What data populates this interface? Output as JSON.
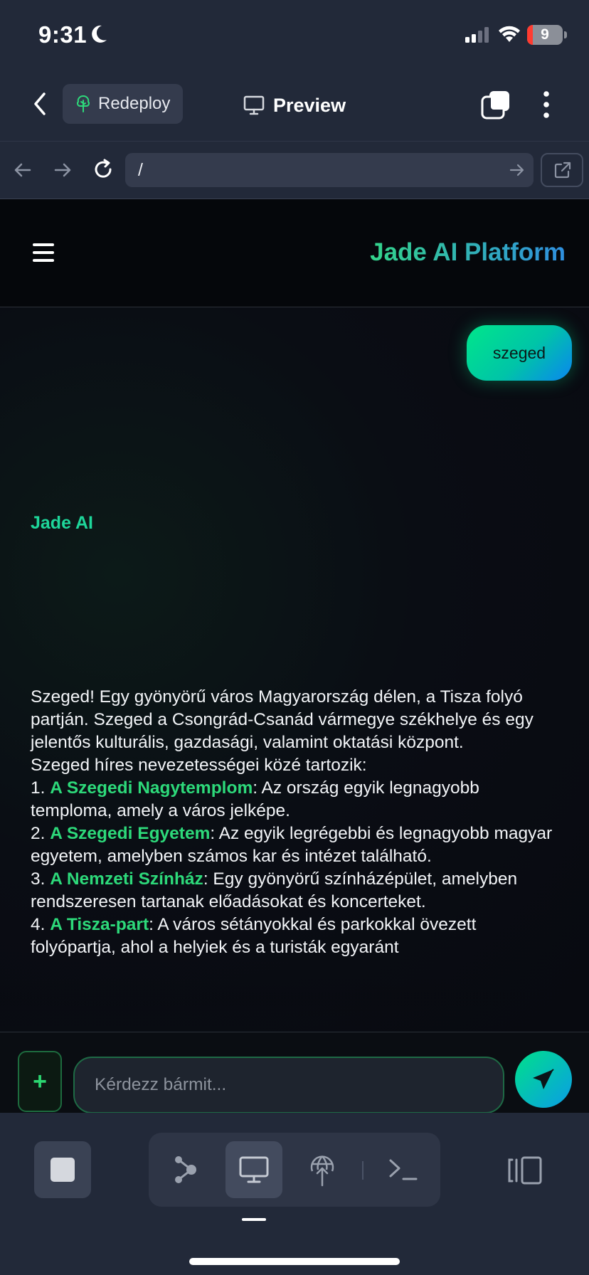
{
  "status_bar": {
    "time": "9:31",
    "battery": "9"
  },
  "nav": {
    "redeploy_label": "Redeploy",
    "preview_label": "Preview"
  },
  "browser": {
    "url": "/"
  },
  "app": {
    "title": "Jade AI Platform"
  },
  "chat": {
    "user_message": "szeged",
    "ai_name": "Jade AI",
    "intro": "Szeged! Egy gyönyörű város Magyarország délen, a Tisza folyó partján. Szeged a Csongrád-Csanád vármegye székhelye és egy jelentős kulturális, gazdasági, valamint oktatási központ.",
    "list_heading": "Szeged híres nevezetességei közé tartozik:",
    "items": [
      {
        "num": "1.",
        "name": "A Szegedi Nagytemplom",
        "desc": ": Az ország egyik legnagyobb temploma, amely a város jelképe."
      },
      {
        "num": "2.",
        "name": "A Szegedi Egyetem",
        "desc": ": Az egyik legrégebbi és legnagyobb magyar egyetem, amelyben számos kar és intézet található."
      },
      {
        "num": "3.",
        "name": "A Nemzeti Színház",
        "desc": ": Egy gyönyörű színházépület, amelyben rendszeresen tartanak előadásokat és koncerteket."
      },
      {
        "num": "4.",
        "name": "A Tisza-part",
        "desc": ": A város sétányokkal és parkokkal övezett folyópartja, ahol a helyiek és a turisták egyaránt"
      }
    ]
  },
  "input": {
    "placeholder": "Kérdezz bármit..."
  },
  "colors": {
    "accent_green": "#2dd97a",
    "accent_blue": "#2f8fe0",
    "background": "#222939"
  }
}
